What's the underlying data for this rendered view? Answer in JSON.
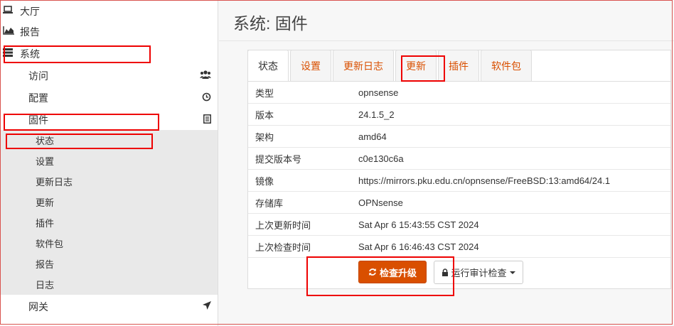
{
  "sidebar": {
    "top": [
      {
        "icon": "laptop-icon",
        "label": "大厅"
      },
      {
        "icon": "area-chart-icon",
        "label": "报告"
      },
      {
        "icon": "server-icon",
        "label": "系统"
      }
    ],
    "system_items": [
      {
        "label": "访问",
        "icon": "users-icon"
      },
      {
        "label": "配置",
        "icon": "history-icon"
      },
      {
        "label": "固件",
        "icon": "document-icon"
      }
    ],
    "firmware_sub": [
      "状态",
      "设置",
      "更新日志",
      "更新",
      "插件",
      "软件包"
    ],
    "system_tail": [
      "报告",
      "日志"
    ],
    "gateway": {
      "label": "网关",
      "icon": "location-arrow-icon"
    }
  },
  "page_title": "系统: 固件",
  "tabs": [
    "状态",
    "设置",
    "更新日志",
    "更新",
    "插件",
    "软件包"
  ],
  "status_rows": [
    {
      "key": "类型",
      "value": "opnsense"
    },
    {
      "key": "版本",
      "value": "24.1.5_2"
    },
    {
      "key": "架构",
      "value": "amd64"
    },
    {
      "key": "提交版本号",
      "value": "c0e130c6a"
    },
    {
      "key": "镜像",
      "value": "https://mirrors.pku.edu.cn/opnsense/FreeBSD:13:amd64/24.1"
    },
    {
      "key": "存储库",
      "value": "OPNsense"
    },
    {
      "key": "上次更新时间",
      "value": "Sat Apr 6 15:43:55 CST 2024"
    },
    {
      "key": "上次检查时间",
      "value": "Sat Apr 6 16:46:43 CST 2024"
    }
  ],
  "buttons": {
    "upgrade_label": "检查升级",
    "audit_label": "运行审计检查"
  },
  "colors": {
    "accent": "#d94f00",
    "highlight_box": "#e00000"
  }
}
